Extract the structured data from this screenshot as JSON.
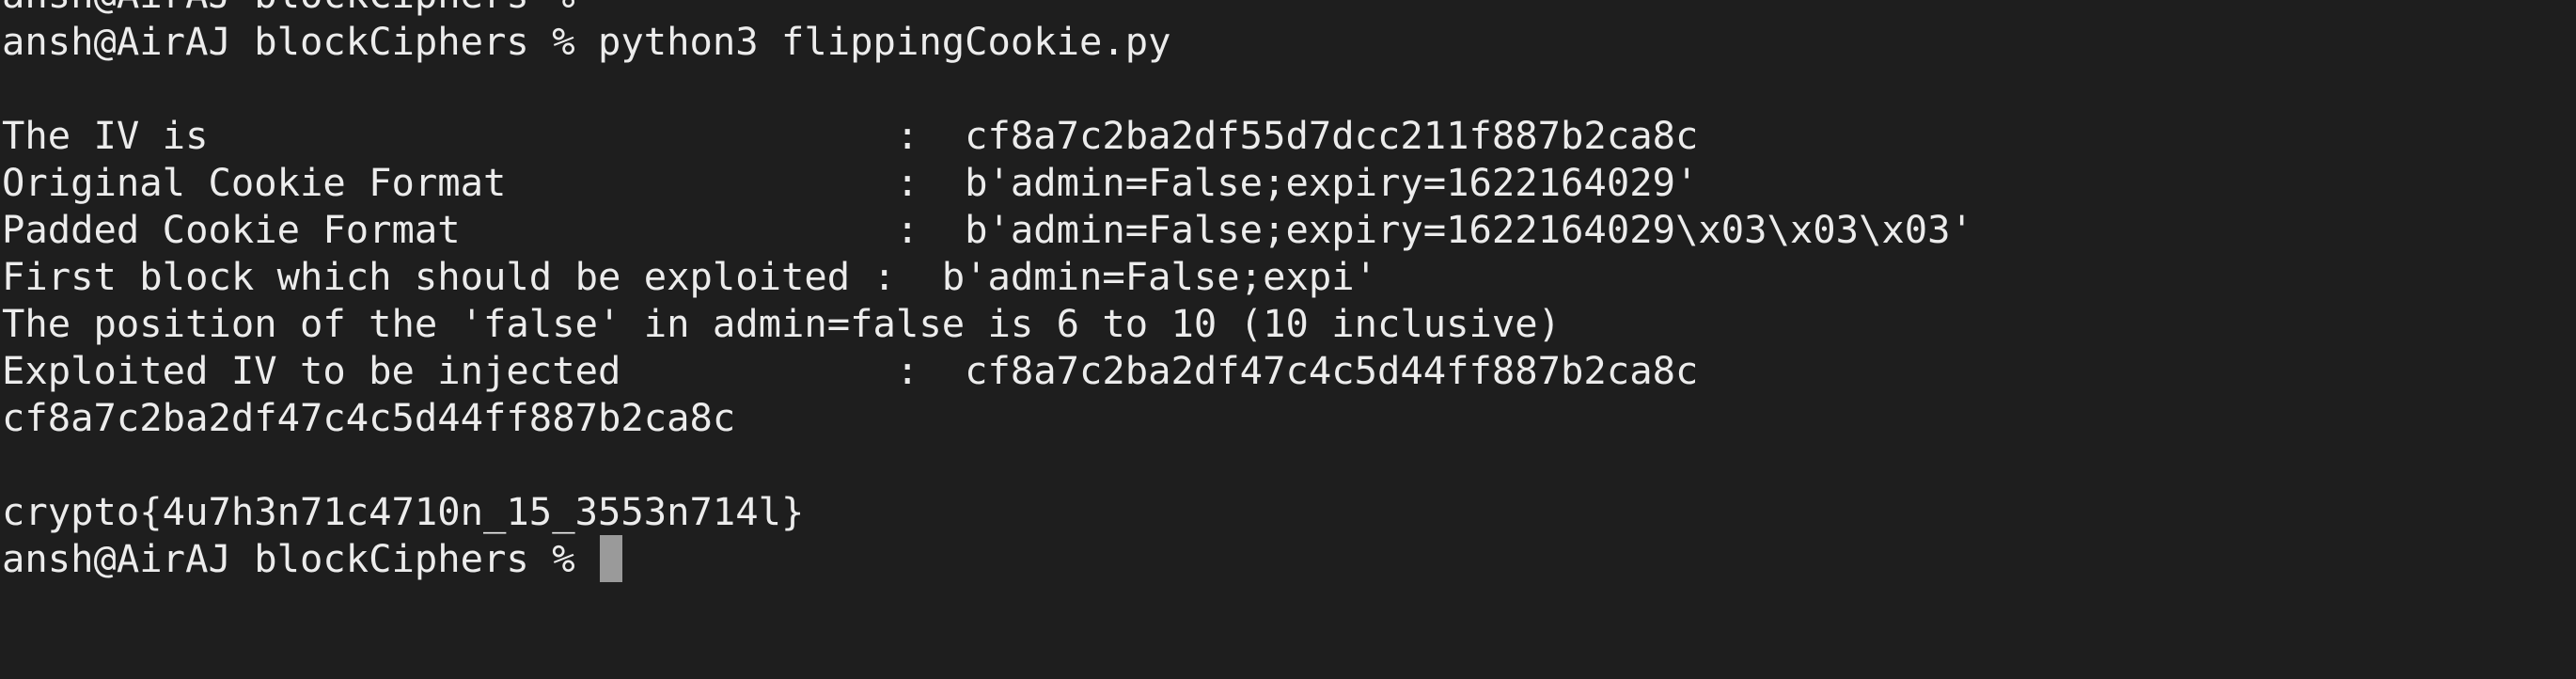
{
  "terminal": {
    "lines": [
      "ansh@AirAJ blockCiphers % ",
      "ansh@AirAJ blockCiphers % python3 flippingCookie.py",
      "",
      "The IV is                              :  cf8a7c2ba2df55d7dcc211f887b2ca8c",
      "Original Cookie Format                 :  b'admin=False;expiry=1622164029'",
      "Padded Cookie Format                   :  b'admin=False;expiry=1622164029\\x03\\x03\\x03'",
      "First block which should be exploited :  b'admin=False;expi'",
      "The position of the 'false' in admin=false is 6 to 10 (10 inclusive)",
      "Exploited IV to be injected            :  cf8a7c2ba2df47c4c5d44ff887b2ca8c",
      "cf8a7c2ba2df47c4c5d44ff887b2ca8c",
      "",
      "crypto{4u7h3n71c4710n_15_3553n714l}"
    ],
    "prompt": "ansh@AirAJ blockCiphers % "
  },
  "colors": {
    "background": "#1e1e1e",
    "foreground": "#ececec",
    "cursor": "#9a9a9a"
  }
}
